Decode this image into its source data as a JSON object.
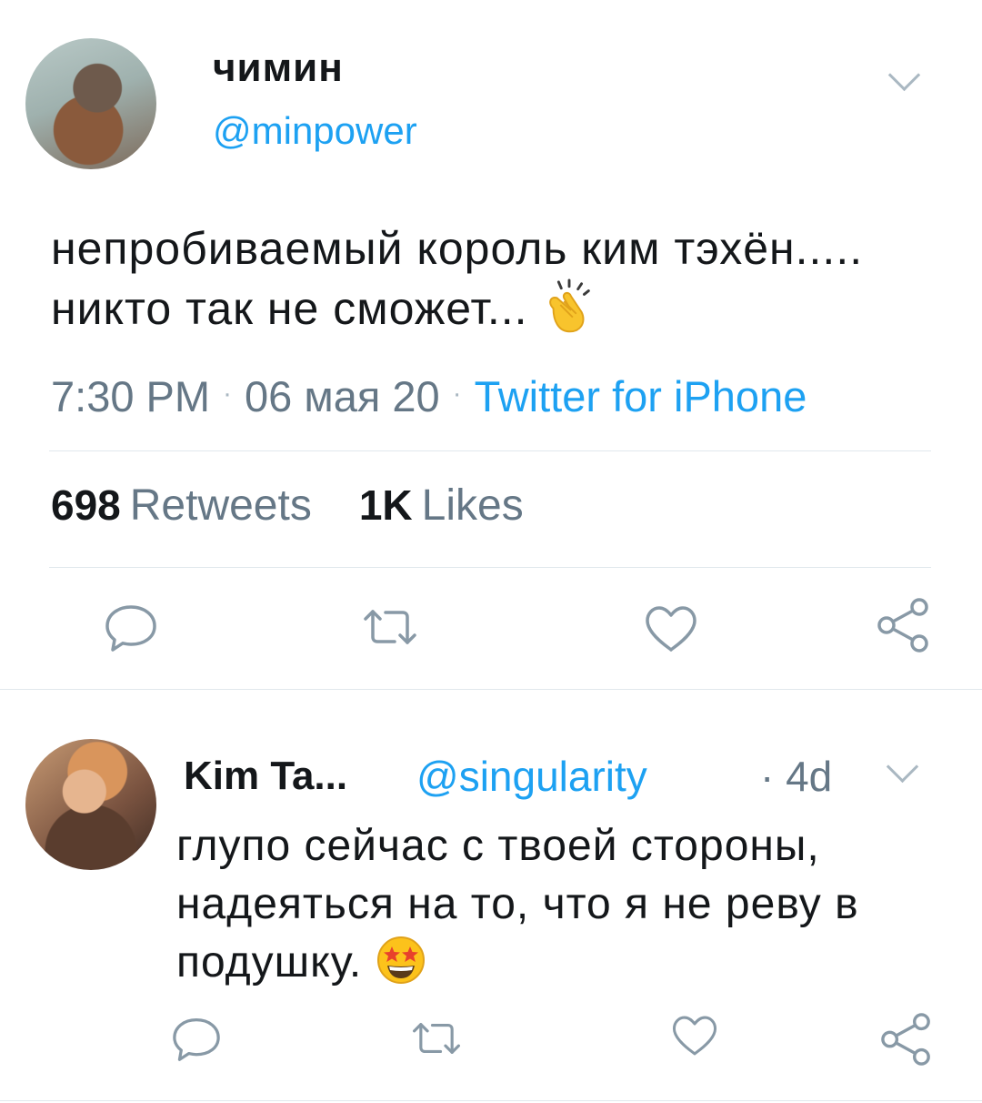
{
  "tweet": {
    "author_name": "чимин",
    "author_handle": "@minpower",
    "text": "непробиваемый король ким тэхён..... никто так не сможет...",
    "emoji": "clapping-hands",
    "time": "7:30 PM",
    "date": "06 мая 20",
    "source": "Twitter for iPhone",
    "retweets_count": "698",
    "retweets_label": "Retweets",
    "likes_count": "1K",
    "likes_label": "Likes",
    "actions": [
      "reply-icon",
      "retweet-icon",
      "like-icon",
      "share-icon"
    ]
  },
  "reply": {
    "author_name": "Kim Ta...",
    "author_handle": "@singularity",
    "time": "· 4d",
    "text": "глупо сейчас с твоей стороны, надеяться на то, что я не реву в подушку.",
    "emoji": "star-struck",
    "actions": [
      "reply-icon",
      "retweet-icon",
      "like-icon",
      "share-icon"
    ]
  },
  "colors": {
    "accent": "#1da1f2",
    "secondary_text": "#657786",
    "icon": "#8899a6",
    "divider": "#e1e8ed"
  }
}
